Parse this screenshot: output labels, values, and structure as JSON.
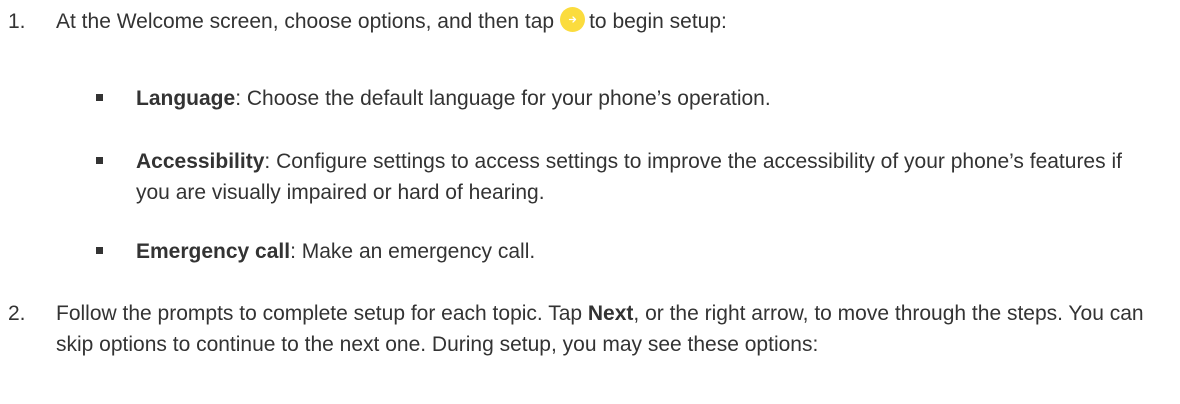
{
  "steps": [
    {
      "number": "1.",
      "text_before_icon": "At the Welcome screen, choose options, and then tap",
      "icon": "arrow-right-icon",
      "text_after_icon": "to begin setup:",
      "bullets": [
        {
          "term": "Language",
          "description": ": Choose the default language for your phone’s operation."
        },
        {
          "term": "Accessibility",
          "description": ": Configure settings to access settings to improve the accessibility of your phone’s features if you are visually impaired or hard of hearing."
        },
        {
          "term": "Emergency call",
          "description": ": Make an emergency call."
        }
      ]
    },
    {
      "number": "2.",
      "text_part1": "Follow the prompts to complete setup for each topic. Tap ",
      "bold_word": "Next",
      "text_part2": ", or the right arrow, to move through the steps. You can skip options to continue to the next one. During setup, you may see these options:"
    }
  ],
  "colors": {
    "text": "#333333",
    "icon_fill": "#fbdc3e",
    "icon_arrow": "#ffffff"
  }
}
